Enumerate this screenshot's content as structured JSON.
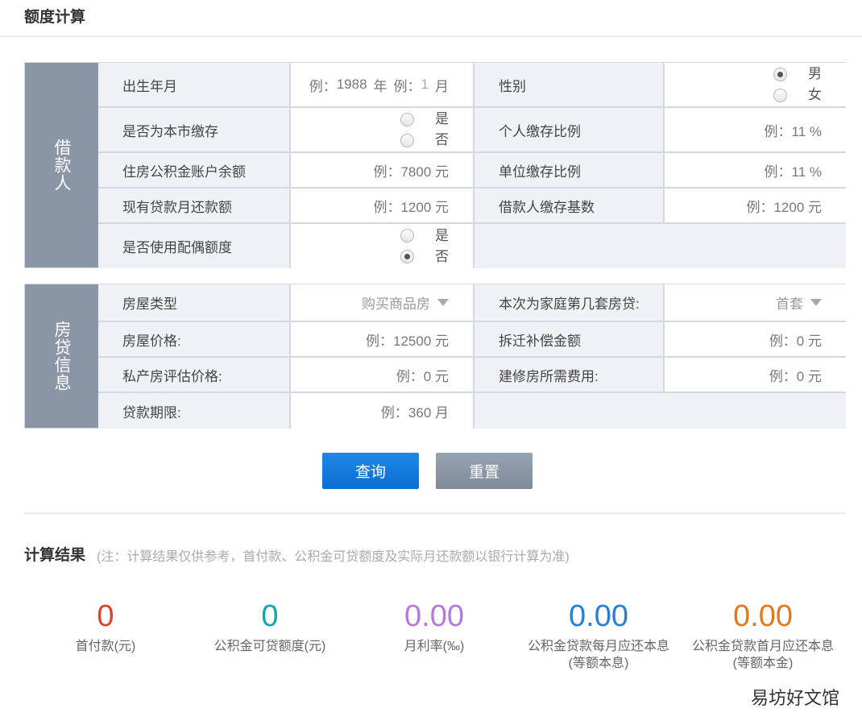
{
  "header": {
    "title": "额度计算"
  },
  "borrower": {
    "section_label": "借款人",
    "birth": {
      "label": "出生年月",
      "year_prefix": "例：",
      "year_value": "1988",
      "year_unit": "年",
      "month_prefix": "例：",
      "month_value": "1",
      "month_unit": "月"
    },
    "gender": {
      "label": "性别",
      "options": [
        {
          "label": "男",
          "selected": true
        },
        {
          "label": "女",
          "selected": false
        }
      ]
    },
    "local_deposit": {
      "label": "是否为本市缴存",
      "options": [
        {
          "label": "是",
          "selected": false
        },
        {
          "label": "否",
          "selected": false
        }
      ]
    },
    "personal_ratio": {
      "label": "个人缴存比例",
      "value": "例：11 %"
    },
    "fund_balance": {
      "label": "住房公积金账户余额",
      "value": "例：7800  元"
    },
    "company_ratio": {
      "label": "单位缴存比例",
      "value": "例：11 %"
    },
    "monthly_repay": {
      "label": "现有贷款月还款额",
      "value": "例：1200  元"
    },
    "deposit_base": {
      "label": "借款人缴存基数",
      "value": "例：1200  元"
    },
    "spouse_quota": {
      "label": "是否使用配偶额度",
      "options": [
        {
          "label": "是",
          "selected": false
        },
        {
          "label": "否",
          "selected": true
        }
      ]
    }
  },
  "loan": {
    "section_label": "房贷信息",
    "house_type": {
      "label": "房屋类型",
      "value": "购买商品房"
    },
    "house_count": {
      "label": "本次为家庭第几套房贷:",
      "value": "首套"
    },
    "price": {
      "label": "房屋价格:",
      "value": "例：12500  元"
    },
    "demolition": {
      "label": "拆迁补偿金额",
      "value": "例：0 元"
    },
    "private_eval": {
      "label": "私产房评估价格:",
      "value": "例：0  元"
    },
    "repair_cost": {
      "label": "建修房所需费用:",
      "value": "例：0 元"
    },
    "term": {
      "label": "贷款期限:",
      "value": "例：360  月"
    }
  },
  "buttons": {
    "query": "查询",
    "reset": "重置"
  },
  "results": {
    "title": "计算结果",
    "note": "(注：计算结果仅供参考，首付款、公积金可贷额度及实际月还款额以银行计算为准)",
    "items": [
      {
        "value": "0",
        "caption": "首付款(元)",
        "caption2": "",
        "color": "#d9432f"
      },
      {
        "value": "0",
        "caption": "公积金可贷额度(元)",
        "caption2": "",
        "color": "#1ba3a8"
      },
      {
        "value": "0.00",
        "caption": "月利率(‰)",
        "caption2": "",
        "color": "#b57ad9"
      },
      {
        "value": "0.00",
        "caption": "公积金贷款每月应还本息",
        "caption2": "(等额本息)",
        "color": "#2a7fd4"
      },
      {
        "value": "0.00",
        "caption": "公积金贷款首月应还本息",
        "caption2": "(等额本金)",
        "color": "#e07a1f"
      }
    ]
  },
  "watermark": "易坊好文馆"
}
